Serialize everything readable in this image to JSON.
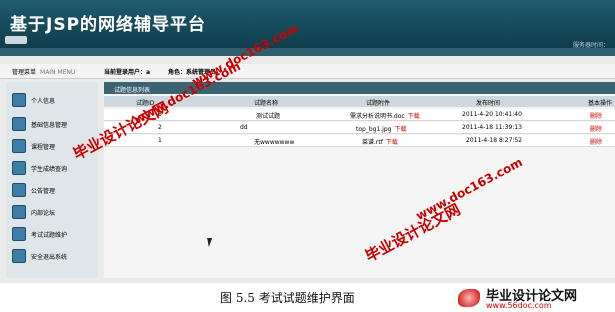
{
  "app": {
    "title": "基于JSP的网络辅导平台",
    "server_time_label": "服务器时间："
  },
  "userbar": {
    "menu_title": "管理菜单",
    "menu_sub": "MAIN MENU",
    "current_user": "当前登录用户：",
    "current_user_value": "a",
    "role_label": "角色：",
    "role_value": "系统管理员"
  },
  "sidebar": {
    "items": [
      {
        "label": "个人信息",
        "icon": "user-icon"
      },
      {
        "label": "基础信息管理",
        "icon": "info-icon"
      },
      {
        "label": "课程管理",
        "icon": "book-icon"
      },
      {
        "label": "学生成绩查询",
        "icon": "score-icon"
      },
      {
        "label": "公告管理",
        "icon": "notice-icon"
      },
      {
        "label": "内部论坛",
        "icon": "forum-icon"
      },
      {
        "label": "考试试题维护",
        "icon": "exam-icon"
      },
      {
        "label": "安全退出系统",
        "icon": "logout-icon"
      }
    ]
  },
  "list": {
    "title": "试题信息列表",
    "columns": [
      "试题ID",
      "试题名称",
      "试题附件",
      "发布时间",
      "基本操作"
    ],
    "rows": [
      {
        "id": "3",
        "name": "测试试题",
        "file": "需求分析说明书.doc",
        "download": "下载",
        "time": "2011-4-20 10:41:40",
        "action": "删除"
      },
      {
        "id": "2",
        "name": "dd",
        "file": "top_bg1.jpg",
        "download": "下载",
        "time": "2011-4-18 11:39:13",
        "action": "删除"
      },
      {
        "id": "1",
        "name": "无wwwwwww",
        "file": "菜谱.rtf",
        "download": "下载",
        "time": "2011-4-18 8:27:52",
        "action": "删除"
      }
    ]
  },
  "watermarks": {
    "a": "毕业设计论文网",
    "b": "www.doc163.com",
    "c": "毕业设计论文网",
    "d": "www.doc163.com",
    "e": "www.doc163.com"
  },
  "caption": "图 5.5 考试试题维护界面",
  "brand": {
    "title": "毕业设计论文网",
    "url": "www.56doc.com"
  },
  "colors": {
    "header": "#1f5c6f",
    "accent": "#cc0000"
  }
}
